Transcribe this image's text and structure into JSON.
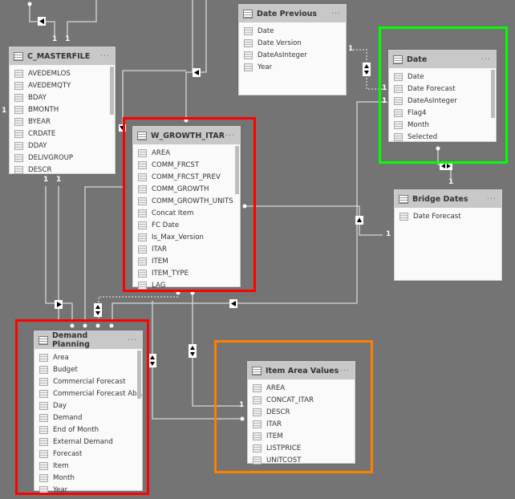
{
  "tables": {
    "c_masterfile": {
      "title": "C_MASTERFILE",
      "columns": [
        "AVEDEMLOS",
        "AVEDEMQTY",
        "BDAY",
        "BMONTH",
        "BYEAR",
        "CRDATE",
        "DDAY",
        "DELIVGROUP",
        "DESCR"
      ]
    },
    "w_growth_itar": {
      "title": "W_GROWTH_ITAR",
      "columns": [
        "AREA",
        "COMM_FRCST",
        "COMM_FRCST_PREV",
        "COMM_GROWTH",
        "COMM_GROWTH_UNITS",
        "Concat Item",
        "FC Date",
        "Is_Max_Version",
        "ITAR",
        "ITEM",
        "ITEM_TYPE",
        "LAG"
      ]
    },
    "date_previous": {
      "title": "Date Previous",
      "columns": [
        "Date",
        "Date Version",
        "DateAsInteger",
        "Year"
      ]
    },
    "date": {
      "title": "Date",
      "columns": [
        "Date",
        "Date Forecast",
        "DateAsInteger",
        "Flag4",
        "Month",
        "Selected"
      ]
    },
    "bridge_dates": {
      "title": "Bridge Dates",
      "columns": [
        "Date Forecast"
      ]
    },
    "demand_planning": {
      "title": "Demand Planning",
      "columns": [
        "Area",
        "Budget",
        "Commercial Forecast",
        "Commercial Forecast Abs...",
        "Day",
        "Demand",
        "End of Month",
        "External Demand",
        "Forecast",
        "Item",
        "Month",
        "Year"
      ]
    },
    "item_area_values": {
      "title": "Item Area Values",
      "columns": [
        "AREA",
        "CONCAT_ITAR",
        "DESCR",
        "ITAR",
        "ITEM",
        "LISTPRICE",
        "UNITCOST"
      ]
    }
  },
  "more_label": "···",
  "cardinality_one": "1",
  "highlight_colors": {
    "red": "#ff0000",
    "green": "#00ff00",
    "orange": "#ff8000"
  }
}
